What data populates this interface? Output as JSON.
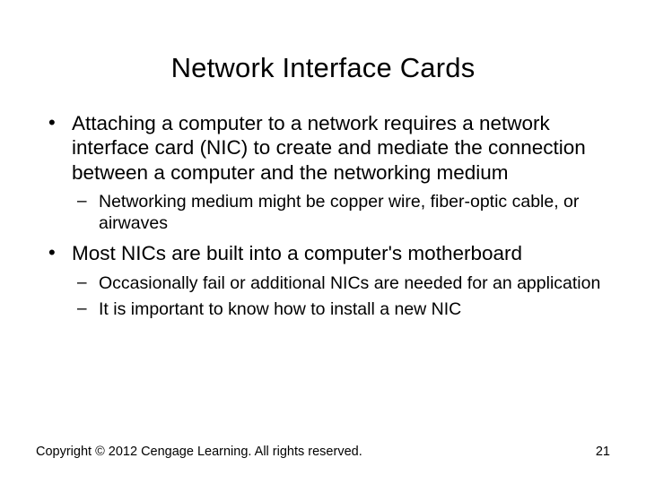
{
  "title": "Network Interface Cards",
  "bullets": [
    {
      "text": "Attaching a computer to a network requires a network interface card (NIC) to create and mediate the connection between a computer and the networking medium",
      "sub": [
        "Networking medium might be copper wire, fiber-optic cable, or airwaves"
      ]
    },
    {
      "text": "Most NICs are built into a computer's motherboard",
      "sub": [
        "Occasionally fail or additional NICs are needed for an application",
        "It is important to know how to install a new NIC"
      ]
    }
  ],
  "footer": "Copyright © 2012 Cengage Learning. All rights reserved.",
  "page_number": "21"
}
